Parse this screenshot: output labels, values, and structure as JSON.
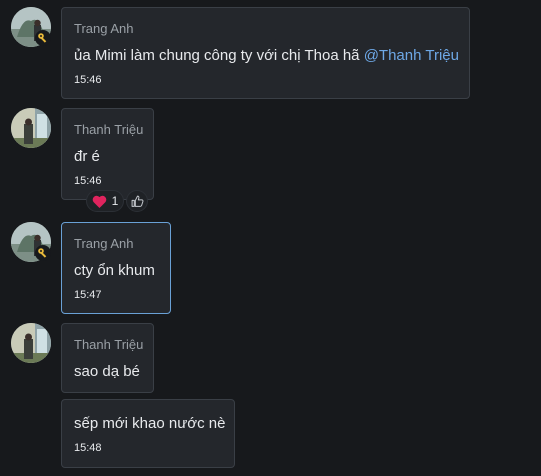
{
  "messages": [
    {
      "sender": "Trang Anh",
      "text": "ủa Mimi làm chung công ty với chị Thoa hã",
      "mention": "@Thanh Triệu",
      "time": "15:46"
    },
    {
      "sender": "Thanh Triệu",
      "text": "đr é",
      "time": "15:46",
      "reaction": {
        "emoji": "heart",
        "count": "1"
      },
      "add_reaction_icon": "thumbs-up-icon"
    },
    {
      "sender": "Trang Anh",
      "text": "cty ổn khum",
      "time": "15:47"
    },
    {
      "sender": "Thanh Triệu",
      "text": "sao dạ bé"
    },
    {
      "text": "sếp mới khao nước nè",
      "time": "15:48"
    }
  ],
  "colors": {
    "background": "#17191c",
    "bubble": "#24272c",
    "mention": "#6ea8e6",
    "highlight_border": "#6aa1d6",
    "heart": "#e0245e",
    "key_badge": "#e8b93a"
  }
}
